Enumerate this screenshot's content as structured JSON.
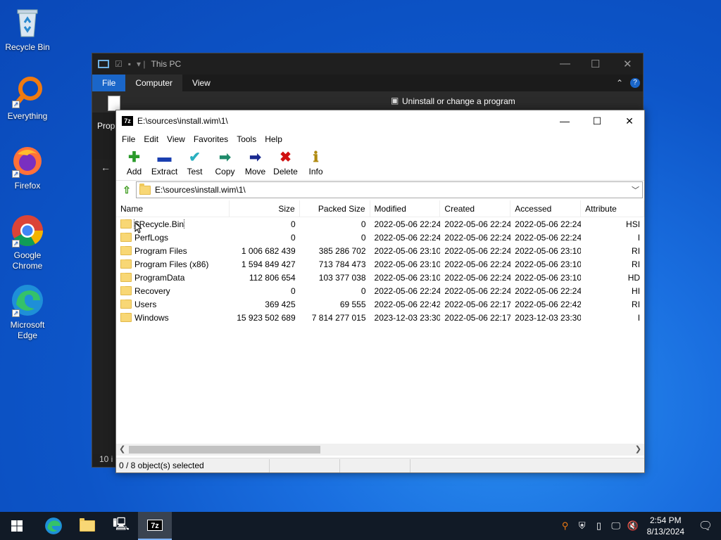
{
  "desktop": {
    "icons": [
      {
        "label": "Recycle Bin",
        "icon": "recycle-bin-icon"
      },
      {
        "label": "Everything",
        "icon": "everything-search-icon"
      },
      {
        "label": "Firefox",
        "icon": "firefox-icon"
      },
      {
        "label": "Google Chrome",
        "icon": "chrome-icon"
      },
      {
        "label": "Microsoft Edge",
        "icon": "edge-icon"
      }
    ]
  },
  "explorer": {
    "title": "This PC",
    "tabs": [
      "File",
      "Computer",
      "View"
    ],
    "ribbon_text": "Uninstall or change a program",
    "ribbon_partial": "Prop",
    "status": "10 i"
  },
  "sevenzip": {
    "logo": "7z",
    "title": "E:\\sources\\install.wim\\1\\",
    "menu": [
      "File",
      "Edit",
      "View",
      "Favorites",
      "Tools",
      "Help"
    ],
    "toolbar": [
      {
        "label": "Add",
        "icon": "add-icon",
        "color": "#2a9a2a"
      },
      {
        "label": "Extract",
        "icon": "extract-icon",
        "color": "#1a3fb0"
      },
      {
        "label": "Test",
        "icon": "test-icon",
        "color": "#2ab0c0"
      },
      {
        "label": "Copy",
        "icon": "copy-icon",
        "color": "#1f8a6a"
      },
      {
        "label": "Move",
        "icon": "move-icon",
        "color": "#1a2a90"
      },
      {
        "label": "Delete",
        "icon": "delete-icon",
        "color": "#d01010"
      },
      {
        "label": "Info",
        "icon": "info-icon",
        "color": "#b08a10"
      }
    ],
    "address": "E:\\sources\\install.wim\\1\\",
    "columns": [
      "Name",
      "Size",
      "Packed Size",
      "Modified",
      "Created",
      "Accessed",
      "Attribute"
    ],
    "rows": [
      {
        "name": "$Recycle.Bin",
        "size": "0",
        "packed": "0",
        "modified": "2022-05-06 22:24",
        "created": "2022-05-06 22:24",
        "accessed": "2022-05-06 22:24",
        "attr": "HSI"
      },
      {
        "name": "PerfLogs",
        "size": "0",
        "packed": "0",
        "modified": "2022-05-06 22:24",
        "created": "2022-05-06 22:24",
        "accessed": "2022-05-06 22:24",
        "attr": "I"
      },
      {
        "name": "Program Files",
        "size": "1 006 682 439",
        "packed": "385 286 702",
        "modified": "2022-05-06 23:10",
        "created": "2022-05-06 22:24",
        "accessed": "2022-05-06 23:10",
        "attr": "RI"
      },
      {
        "name": "Program Files (x86)",
        "size": "1 594 849 427",
        "packed": "713 784 473",
        "modified": "2022-05-06 23:10",
        "created": "2022-05-06 22:24",
        "accessed": "2022-05-06 23:10",
        "attr": "RI"
      },
      {
        "name": "ProgramData",
        "size": "112 806 654",
        "packed": "103 377 038",
        "modified": "2022-05-06 23:10",
        "created": "2022-05-06 22:24",
        "accessed": "2022-05-06 23:10",
        "attr": "HD"
      },
      {
        "name": "Recovery",
        "size": "0",
        "packed": "0",
        "modified": "2022-05-06 22:24",
        "created": "2022-05-06 22:24",
        "accessed": "2022-05-06 22:24",
        "attr": "HI"
      },
      {
        "name": "Users",
        "size": "369 425",
        "packed": "69 555",
        "modified": "2022-05-06 22:42",
        "created": "2022-05-06 22:17",
        "accessed": "2022-05-06 22:42",
        "attr": "RI"
      },
      {
        "name": "Windows",
        "size": "15 923 502 689",
        "packed": "7 814 277 015",
        "modified": "2023-12-03 23:30",
        "created": "2022-05-06 22:17",
        "accessed": "2023-12-03 23:30",
        "attr": "I"
      }
    ],
    "status": "0 / 8 object(s) selected"
  },
  "taskbar": {
    "time": "2:54 PM",
    "date": "8/13/2024",
    "accent": "#7fb3ff"
  }
}
